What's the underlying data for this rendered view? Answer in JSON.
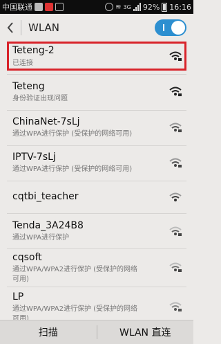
{
  "status": {
    "carrier": "中国联通",
    "signal": "3G",
    "battery": "92%",
    "time": "16:16"
  },
  "header": {
    "title": "WLAN",
    "wifi_enabled": true
  },
  "networks": [
    {
      "ssid": "Teteng-2",
      "status": "已连接",
      "locked": true,
      "selected": true
    },
    {
      "ssid": "Teteng",
      "status": "身份验证出现问题",
      "locked": true
    },
    {
      "ssid": "ChinaNet-7sLj",
      "status": "通过WPA进行保护 (受保护的网络可用)",
      "locked": true
    },
    {
      "ssid": "IPTV-7sLj",
      "status": "通过WPA进行保护 (受保护的网络可用)",
      "locked": true
    },
    {
      "ssid": "cqtbi_teacher",
      "status": "",
      "locked": false
    },
    {
      "ssid": "Tenda_3A24B8",
      "status": "通过WPA进行保护",
      "locked": true
    },
    {
      "ssid": "cqsoft",
      "status_line1": "通过WPA/WPA2进行保护 (受保护的网络",
      "status_line2": "可用)",
      "locked": true
    },
    {
      "ssid": "LP",
      "status_line1": "通过WPA/WPA2进行保护 (受保护的网络",
      "status_line2": "可用)",
      "locked": true
    }
  ],
  "bottom": {
    "scan_label": "扫描",
    "direct_label": "WLAN 直连"
  },
  "colors": {
    "accent": "#2d8fd0",
    "highlight": "#d8232a"
  }
}
